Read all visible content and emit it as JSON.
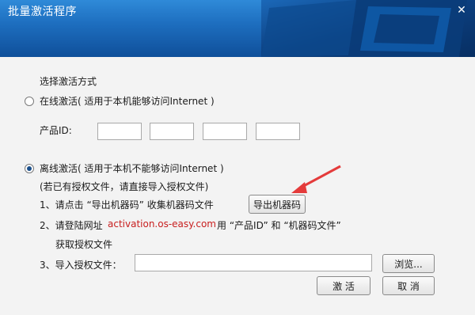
{
  "window": {
    "title": "批量激活程序",
    "close_glyph": "✕"
  },
  "section": {
    "title": "选择激活方式"
  },
  "online": {
    "label": "在线激活( 适用于本机能够访问Internet )",
    "product_id_label": "产品ID:",
    "product_id_values": [
      "",
      "",
      "",
      ""
    ]
  },
  "offline": {
    "label": "离线激活( 适用于本机不能够访问Internet )",
    "note": "(若已有授权文件，请直接导入授权文件)",
    "step1": {
      "text": "1、请点击 “导出机器码” 收集机器码文件",
      "button": "导出机器码"
    },
    "step2": {
      "prefix": "2、请登陆网址",
      "url": "activation.os-easy.com",
      "suffix": "用 “产品ID” 和 “机器码文件”",
      "line2": "获取授权文件"
    },
    "step3": {
      "label": "3、导入授权文件：",
      "value": "",
      "browse": "浏览..."
    }
  },
  "footer": {
    "activate": "激  活",
    "cancel": "取  消"
  },
  "colors": {
    "title_bg": "#1e6fc0",
    "link": "#c81e1e",
    "arrow": "#e43b3b"
  },
  "icons": {
    "close": "close-icon",
    "arrow": "annotation-arrow-icon"
  },
  "selected_mode": "offline"
}
